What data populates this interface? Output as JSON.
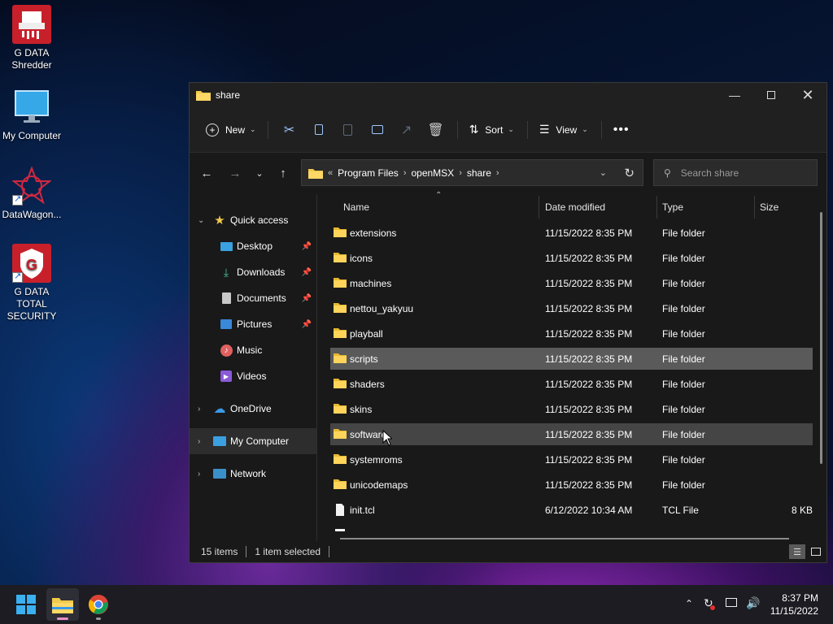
{
  "desktop": {
    "icons": [
      {
        "label": "G DATA Shredder"
      },
      {
        "label": "My Computer"
      },
      {
        "label": "DataWagon..."
      },
      {
        "label": "G DATA TOTAL SECURITY"
      }
    ]
  },
  "window": {
    "title": "share",
    "toolbar": {
      "new_label": "New",
      "sort_label": "Sort",
      "view_label": "View"
    },
    "breadcrumb": [
      "Program Files",
      "openMSX",
      "share"
    ],
    "search_placeholder": "Search share",
    "nav": {
      "quick_access": "Quick access",
      "items": [
        {
          "label": "Desktop",
          "pinned": true
        },
        {
          "label": "Downloads",
          "pinned": true
        },
        {
          "label": "Documents",
          "pinned": true
        },
        {
          "label": "Pictures",
          "pinned": true
        },
        {
          "label": "Music",
          "pinned": false
        },
        {
          "label": "Videos",
          "pinned": false
        }
      ],
      "onedrive": "OneDrive",
      "my_computer": "My Computer",
      "network": "Network"
    },
    "columns": {
      "name": "Name",
      "date": "Date modified",
      "type": "Type",
      "size": "Size"
    },
    "files": [
      {
        "name": "extensions",
        "date": "11/15/2022 8:35 PM",
        "type": "File folder",
        "size": ""
      },
      {
        "name": "icons",
        "date": "11/15/2022 8:35 PM",
        "type": "File folder",
        "size": ""
      },
      {
        "name": "machines",
        "date": "11/15/2022 8:35 PM",
        "type": "File folder",
        "size": ""
      },
      {
        "name": "nettou_yakyuu",
        "date": "11/15/2022 8:35 PM",
        "type": "File folder",
        "size": ""
      },
      {
        "name": "playball",
        "date": "11/15/2022 8:35 PM",
        "type": "File folder",
        "size": ""
      },
      {
        "name": "scripts",
        "date": "11/15/2022 8:35 PM",
        "type": "File folder",
        "size": ""
      },
      {
        "name": "shaders",
        "date": "11/15/2022 8:35 PM",
        "type": "File folder",
        "size": ""
      },
      {
        "name": "skins",
        "date": "11/15/2022 8:35 PM",
        "type": "File folder",
        "size": ""
      },
      {
        "name": "software",
        "date": "11/15/2022 8:35 PM",
        "type": "File folder",
        "size": ""
      },
      {
        "name": "systemroms",
        "date": "11/15/2022 8:35 PM",
        "type": "File folder",
        "size": ""
      },
      {
        "name": "unicodemaps",
        "date": "11/15/2022 8:35 PM",
        "type": "File folder",
        "size": ""
      },
      {
        "name": "init.tcl",
        "date": "6/12/2022 10:34 AM",
        "type": "TCL File",
        "size": "8 KB"
      }
    ],
    "status": {
      "items": "15 items",
      "selected": "1 item selected"
    }
  },
  "taskbar": {
    "time": "8:37 PM",
    "date": "11/15/2022"
  },
  "colors": {
    "accent": "#60cdff",
    "folder": "#f2c94c",
    "selected_row": "#5a5a5a"
  }
}
